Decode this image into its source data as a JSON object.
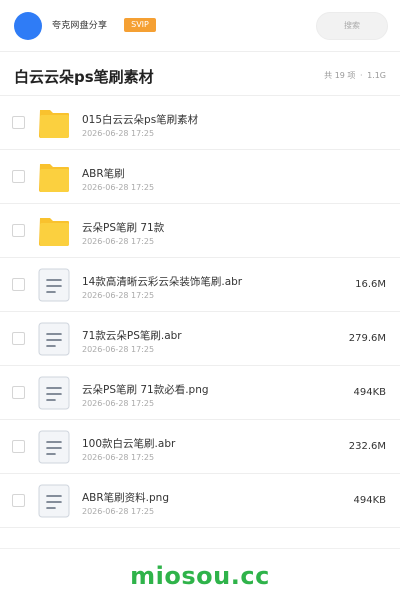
{
  "header": {
    "brand": "夸克网盘分享",
    "badge": "SVIP",
    "search_placeholder": "搜索"
  },
  "folder": {
    "title": "白云云朵ps笔刷素材",
    "count_text": "共 19 项",
    "separator": "·",
    "size_text": "1.1G"
  },
  "files": [
    {
      "type": "folder",
      "name": "015白云云朵ps笔刷素材",
      "date": "2026-06-28 17:25",
      "size": ""
    },
    {
      "type": "folder",
      "name": "ABR笔刷",
      "date": "2026-06-28 17:25",
      "size": ""
    },
    {
      "type": "folder",
      "name": "云朵PS笔刷 71款",
      "date": "2026-06-28 17:25",
      "size": ""
    },
    {
      "type": "file",
      "name": "14款高清晰云彩云朵装饰笔刷.abr",
      "date": "2026-06-28 17:25",
      "size": "16.6M"
    },
    {
      "type": "file",
      "name": "71款云朵PS笔刷.abr",
      "date": "2026-06-28 17:25",
      "size": "279.6M"
    },
    {
      "type": "file",
      "name": "云朵PS笔刷 71款必看.png",
      "date": "2026-06-28 17:25",
      "size": "494KB"
    },
    {
      "type": "file",
      "name": "100款白云笔刷.abr",
      "date": "2026-06-28 17:25",
      "size": "232.6M"
    },
    {
      "type": "file",
      "name": "ABR笔刷资料.png",
      "date": "2026-06-28 17:25",
      "size": "494KB"
    }
  ],
  "footer": {
    "watermark": "miosou.cc"
  },
  "colors": {
    "accent": "#2f7cf6",
    "badge": "#f5a033",
    "folder": "#f9c22e",
    "watermark": "#2fb34a"
  }
}
